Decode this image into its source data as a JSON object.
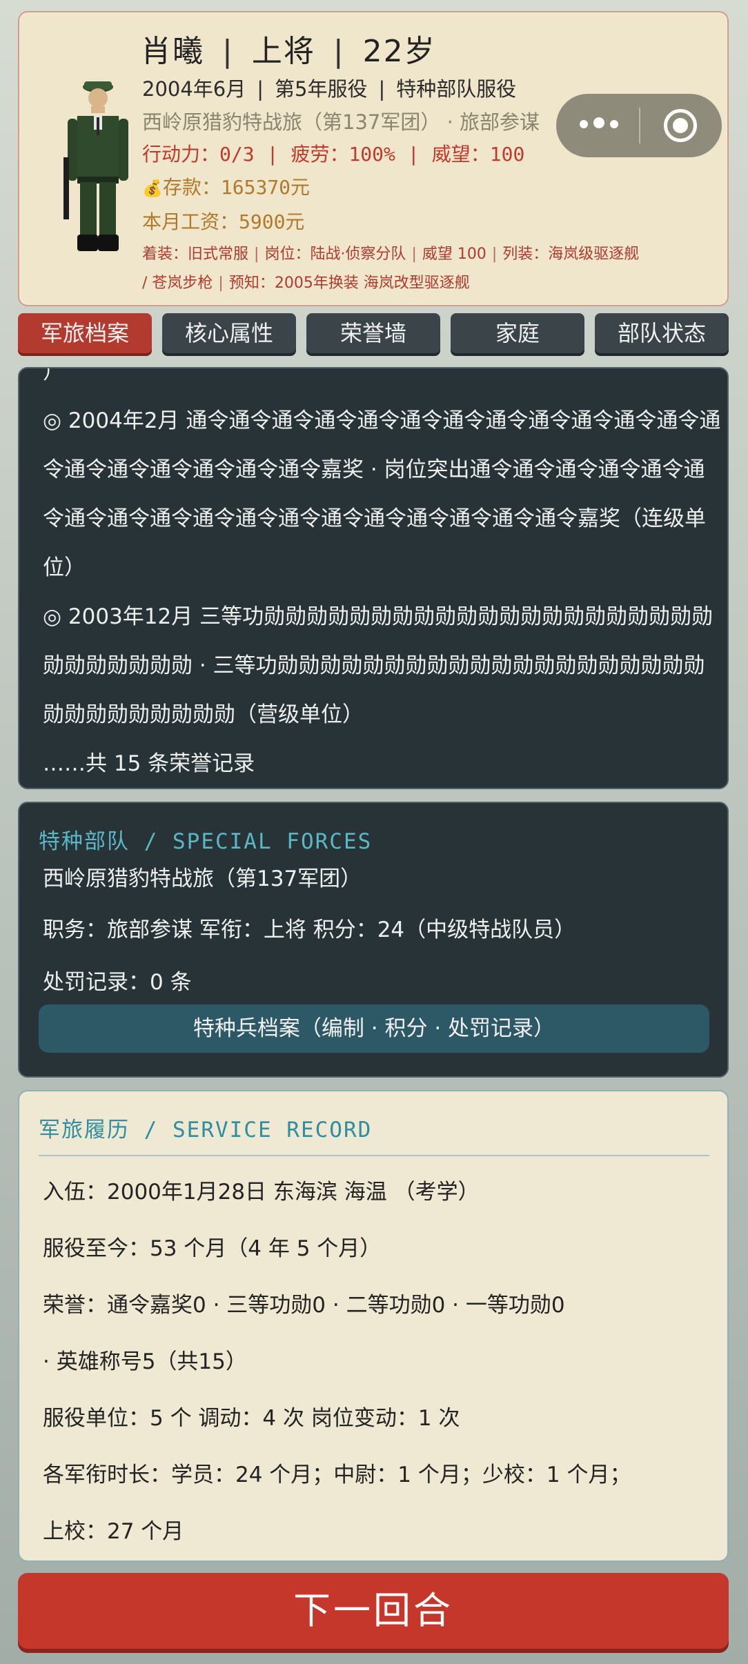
{
  "profile": {
    "name": "肖曦",
    "rank": "上将",
    "age": "22岁",
    "enlist_date": "2004年6月",
    "service_year": "第5年服役",
    "service_type": "特种部队服役",
    "unit_line": "西岭原猎豹特战旅（第137军团） · 旅部参谋",
    "action": "行动力：0/3",
    "fatigue": "疲劳：100%",
    "prestige": "威望：100",
    "money_icon": "💰",
    "savings": "存款：165370元",
    "salary": "本月工资：5900元",
    "equip": [
      "着装：旧式常服",
      "岗位：陆战·侦察分队",
      "威望 100",
      "列装：海岚级驱逐舰",
      "/ 苍岚步枪",
      "预知：2005年换装 海岚改型驱逐舰"
    ],
    "equip_sep": "|"
  },
  "tabs": [
    {
      "label": "军旅档案",
      "active": true
    },
    {
      "label": "核心属性",
      "active": false
    },
    {
      "label": "荣誉墙",
      "active": false
    },
    {
      "label": "家庭",
      "active": false
    },
    {
      "label": "部队状态",
      "active": false
    }
  ],
  "honors": {
    "top_fragment": "）",
    "entry1": "◎ 2004年2月 通令通令通令通令通令通令通令通令通令通令通令通令通令通令通令通令通令通令通令嘉奖 · 岗位突出通令通令通令通令通令通令通令通令通令通令通令通令通令通令通令通令通令通令嘉奖（连级单位）",
    "entry2": "◎ 2003年12月 三等功勋勋勋勋勋勋勋勋勋勋勋勋勋勋勋勋勋勋勋勋勋勋勋勋勋勋勋勋 · 三等功勋勋勋勋勋勋勋勋勋勋勋勋勋勋勋勋勋勋勋勋勋勋勋勋勋勋勋勋勋（营级单位）",
    "total": "……共 15 条荣誉记录"
  },
  "special": {
    "title": "特种部队 / SPECIAL FORCES",
    "unit": "西岭原猎豹特战旅（第137军团）",
    "duty_line": "职务：旅部参谋  军衔：上将  积分：24（中级特战队员）",
    "punish": "处罚记录：0 条",
    "button": "特种兵档案（编制 · 积分 · 处罚记录）"
  },
  "record": {
    "title": "军旅履历 / SERVICE RECORD",
    "enlist": "入伍：2000年1月28日  东海滨 海温  （考学）",
    "served": "服役至今：53 个月（4 年 5 个月）",
    "honors_a": "荣誉：通令嘉奖0 · 三等功勋0 · 二等功勋0 · 一等功勋0",
    "honors_b": " · 英雄称号5（共15）",
    "units": "服役单位：5 个  调动：4 次  岗位变动：1 次",
    "rank_time_a": "各军衔时长：学员：24 个月；中尉：1 个月；少校：1 个月；",
    "rank_time_b": "上校：27 个月"
  },
  "next_button": "下一回合",
  "colors": {
    "accent_red": "#c5362b",
    "dark_panel": "#283338",
    "cream": "#efe6cc",
    "teal": "#2f8ea0"
  }
}
